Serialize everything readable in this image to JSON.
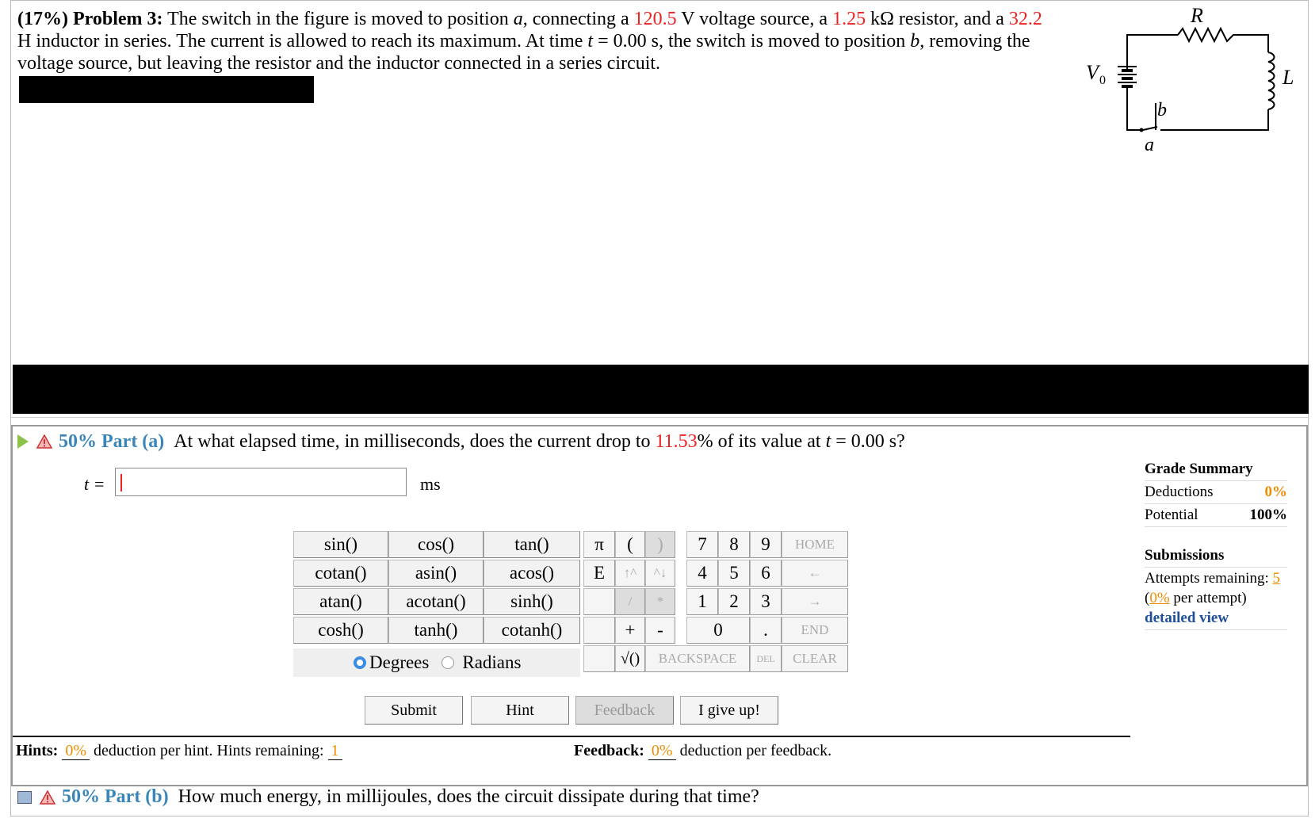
{
  "problem": {
    "pct": "(17%)",
    "label": "Problem 3:",
    "s1": "The switch in the figure is moved to position ",
    "a": "a",
    "s2": ", connecting a ",
    "v": "120.5",
    "s3": " V voltage source, a ",
    "r": "1.25",
    "s4": " kΩ resistor, and a ",
    "l": "32.2",
    "s5": " H inductor in series. The current is allowed to reach its maximum. At time ",
    "t": "t",
    "s6": " = 0.00 s, the switch is moved to position ",
    "b": "b",
    "s7": ", removing the voltage source, but leaving the resistor and the inductor connected in a series circuit."
  },
  "circuit": {
    "R": "R",
    "L": "L",
    "V0": "V",
    "V0_sub": "0",
    "b": "b",
    "a": "a"
  },
  "part_a": {
    "percent_label": "50% Part (a)",
    "q1": "At what elapsed time, in milliseconds, does the current drop to ",
    "pct": "11.53",
    "q2": "% of its value at ",
    "t": "t",
    "q3": " = 0.00 s?",
    "var": "t =",
    "unit": "ms",
    "input_value": ""
  },
  "keypad": {
    "funcs": [
      "sin()",
      "cos()",
      "tan()",
      "cotan()",
      "asin()",
      "acos()",
      "atan()",
      "acotan()",
      "sinh()",
      "cosh()",
      "tanh()",
      "cotanh()"
    ],
    "degrees": "Degrees",
    "radians": "Radians",
    "pi": "π",
    "lparen": "(",
    "rparen": ")",
    "k7": "7",
    "k8": "8",
    "k9": "9",
    "home": "HOME",
    "e": "E",
    "up": "↑^",
    "down": "^↓",
    "k4": "4",
    "k5": "5",
    "k6": "6",
    "left": "←",
    "div": "/",
    "mul": "*",
    "k1": "1",
    "k2": "2",
    "k3": "3",
    "right": "→",
    "plus": "+",
    "minus": "-",
    "k0": "0",
    "dot": ".",
    "end": "END",
    "sqrt": "√()",
    "backspace": "BACKSPACE",
    "del": "DEL",
    "clear": "CLEAR"
  },
  "actions": {
    "submit": "Submit",
    "hint": "Hint",
    "feedback": "Feedback",
    "giveup": "I give up!"
  },
  "hints": {
    "label": "Hints:",
    "pct": "0%",
    "text": "deduction per hint. Hints remaining:",
    "remaining": "1"
  },
  "feedback": {
    "label": "Feedback:",
    "pct": "0%",
    "text": "deduction per feedback."
  },
  "grade": {
    "title": "Grade Summary",
    "deductions_label": "Deductions",
    "deductions": "0%",
    "potential_label": "Potential",
    "potential": "100%",
    "submissions_title": "Submissions",
    "attempts_label": "Attempts remaining:",
    "attempts": "5",
    "per_open": "(",
    "per_pct": "0%",
    "per_text": " per attempt)",
    "detailed": "detailed view"
  },
  "part_b": {
    "percent_label": "50% Part (b)",
    "question": "How much energy, in millijoules, does the circuit dissipate during that time?"
  }
}
